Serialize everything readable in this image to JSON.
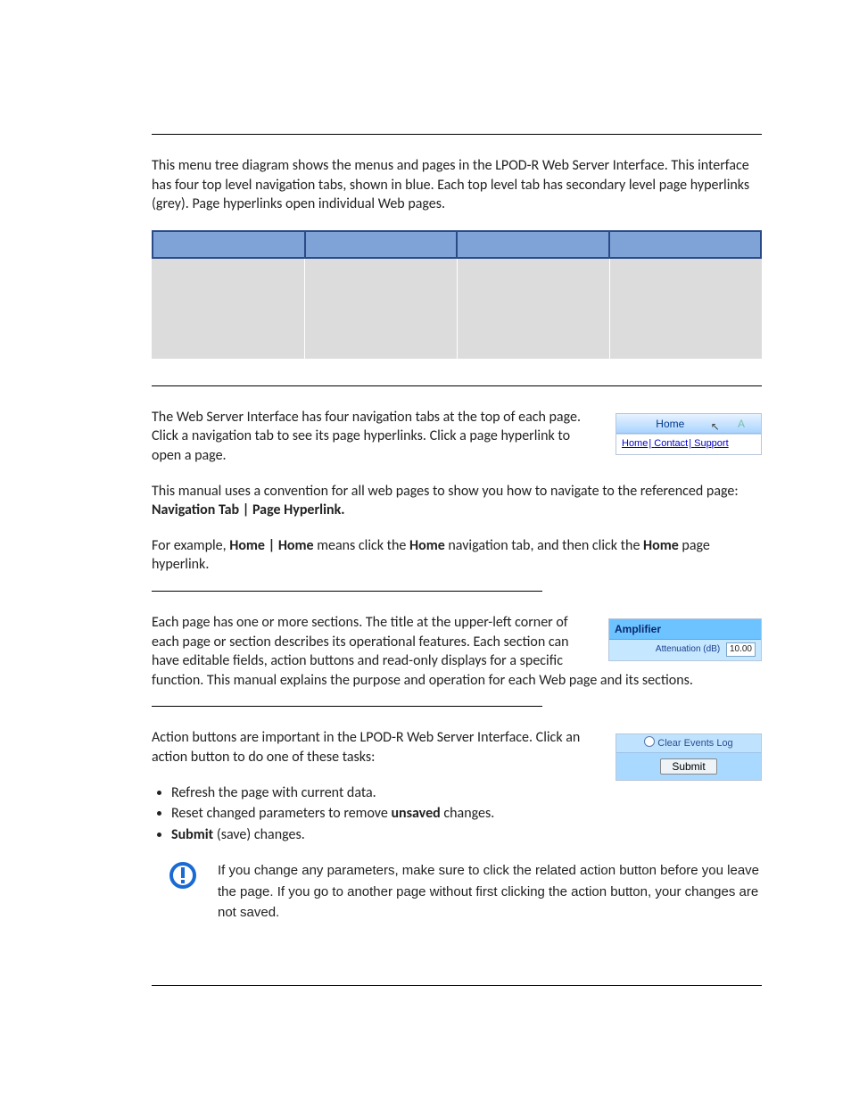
{
  "intro": "This menu tree diagram shows the menus and pages in the LPOD-R Web Server Interface. This interface has four top level navigation tabs, shown in blue. Each top level tab has secondary level page hyperlinks (grey). Page hyperlinks open individual Web pages.",
  "nav_section": {
    "p1": "The Web Server Interface has four navigation tabs at the top of each page. Click a navigation tab to see its page hyperlinks. Click a page hyperlink to open a page.",
    "p2_a": "This manual uses a convention for all web pages to show you how to navigate to the referenced page: ",
    "p2_b": "Navigation Tab | Page Hyperlink.",
    "p3_a": "For example, ",
    "p3_b": "Home | Home",
    "p3_c": " means click the ",
    "p3_d": "Home",
    "p3_e": " navigation tab, and then click the ",
    "p3_f": "Home",
    "p3_g": " page hyperlink."
  },
  "fig_nav": {
    "tab1": "Home",
    "tab_right": "A",
    "link1": "Home",
    "link2": "Contact",
    "link3": "Support"
  },
  "sections_p": "Each page has one or more sections. The title at the upper-left corner of each page or section describes its operational features. Each section can have editable fields, action buttons and read-only displays for a specific function. This manual explains the purpose and operation for each Web page and its sections.",
  "fig_amp": {
    "title": "Amplifier",
    "row_label": "Attenuation (dB)",
    "row_value": "10.00"
  },
  "actions": {
    "p_a": "Action buttons are important in the LPOD-R Web Server Interface. Click an action button to do one of these tasks:",
    "li1": "Refresh the page with current data.",
    "li2_a": "Reset changed parameters to remove ",
    "li2_b": "unsaved",
    "li2_c": " changes.",
    "li3_a": "Submit",
    "li3_b": " (save) changes."
  },
  "fig_submit": {
    "top_label": "Clear Events Log",
    "button": "Submit"
  },
  "note": "If you change any parameters, make sure to click the related action button before you leave the page. If you go to another page without first clicking the action button, your changes are not saved."
}
